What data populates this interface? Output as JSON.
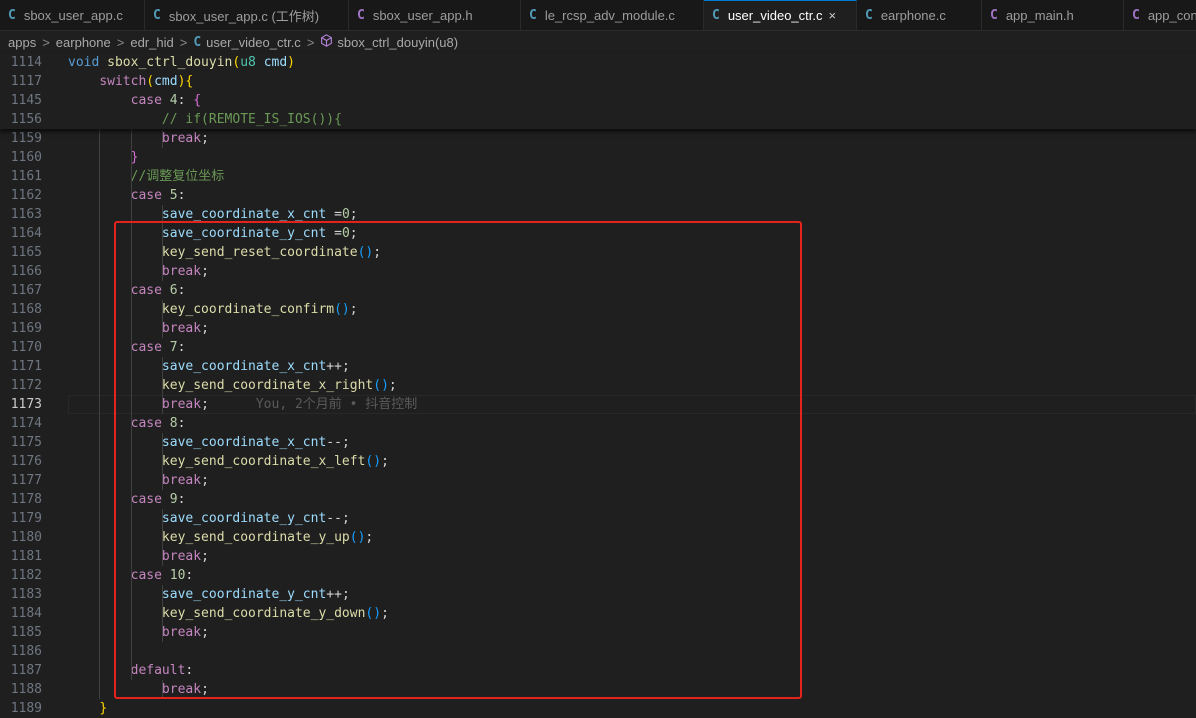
{
  "tabs": [
    {
      "icon": "C",
      "label": "sbox_user_app.c",
      "icon_color": "#519aba",
      "active": false
    },
    {
      "icon": "C",
      "label": "sbox_user_app.c (工作树)",
      "icon_color": "#519aba",
      "active": false
    },
    {
      "icon": "C",
      "label": "sbox_user_app.h",
      "icon_color": "#a074c4",
      "active": false
    },
    {
      "icon": "C",
      "label": "le_rcsp_adv_module.c",
      "icon_color": "#519aba",
      "active": false
    },
    {
      "icon": "C",
      "label": "user_video_ctr.c",
      "icon_color": "#519aba",
      "active": true,
      "close": "×"
    },
    {
      "icon": "C",
      "label": "earphone.c",
      "icon_color": "#519aba",
      "active": false
    },
    {
      "icon": "C",
      "label": "app_main.h",
      "icon_color": "#a074c4",
      "active": false
    },
    {
      "icon": "C",
      "label": "app_config.h",
      "icon_color": "#a074c4",
      "active": false
    }
  ],
  "breadcrumb": {
    "items": [
      "apps",
      "earphone",
      "edr_hid"
    ],
    "file_icon": "C",
    "file": "user_video_ctr.c",
    "symbol_icon": "cube-icon",
    "symbol": "sbox_ctrl_douyin(u8)"
  },
  "sticky_lines": [
    {
      "n": "1114",
      "t": [
        [
          "void",
          "kw"
        ],
        [
          " ",
          ""
        ],
        [
          "sbox_ctrl_douyin",
          "fn"
        ],
        [
          "(",
          "p1"
        ],
        [
          "u8",
          "ty"
        ],
        [
          " ",
          ""
        ],
        [
          "cmd",
          "var"
        ],
        [
          ")",
          "p1"
        ]
      ]
    },
    {
      "n": "1117",
      "t": [
        [
          "    ",
          ""
        ],
        [
          "switch",
          "ctl"
        ],
        [
          "(",
          "p1"
        ],
        [
          "cmd",
          "var"
        ],
        [
          ")",
          "p1"
        ],
        [
          "{",
          "p1"
        ]
      ]
    },
    {
      "n": "1145",
      "t": [
        [
          "        ",
          ""
        ],
        [
          "case",
          "ctl"
        ],
        [
          " ",
          ""
        ],
        [
          "4",
          "num"
        ],
        [
          ": ",
          "op"
        ],
        [
          "{",
          "p2"
        ]
      ]
    },
    {
      "n": "1156",
      "t": [
        [
          "            ",
          ""
        ],
        [
          "// if(REMOTE_IS_IOS()){",
          "cm"
        ]
      ]
    }
  ],
  "lines": [
    {
      "n": "1159",
      "t": [
        [
          "            ",
          ""
        ],
        [
          "break",
          "ctl"
        ],
        [
          ";",
          "op"
        ]
      ]
    },
    {
      "n": "1160",
      "t": [
        [
          "        ",
          ""
        ],
        [
          "}",
          "p2"
        ]
      ]
    },
    {
      "n": "1161",
      "t": [
        [
          "        ",
          ""
        ],
        [
          "//调整复位坐标",
          "cm"
        ]
      ]
    },
    {
      "n": "1162",
      "t": [
        [
          "        ",
          ""
        ],
        [
          "case",
          "ctl"
        ],
        [
          " ",
          ""
        ],
        [
          "5",
          "num"
        ],
        [
          ":",
          "op"
        ]
      ]
    },
    {
      "n": "1163",
      "t": [
        [
          "            ",
          ""
        ],
        [
          "save_coordinate_x_cnt",
          "var"
        ],
        [
          " =",
          "op"
        ],
        [
          "0",
          "num"
        ],
        [
          ";",
          "op"
        ]
      ]
    },
    {
      "n": "1164",
      "t": [
        [
          "            ",
          ""
        ],
        [
          "save_coordinate_y_cnt",
          "var"
        ],
        [
          " =",
          "op"
        ],
        [
          "0",
          "num"
        ],
        [
          ";",
          "op"
        ]
      ]
    },
    {
      "n": "1165",
      "t": [
        [
          "            ",
          ""
        ],
        [
          "key_send_reset_coordinate",
          "fn"
        ],
        [
          "()",
          "p3"
        ],
        [
          ";",
          "op"
        ]
      ]
    },
    {
      "n": "1166",
      "t": [
        [
          "            ",
          ""
        ],
        [
          "break",
          "ctl"
        ],
        [
          ";",
          "op"
        ]
      ]
    },
    {
      "n": "1167",
      "t": [
        [
          "        ",
          ""
        ],
        [
          "case",
          "ctl"
        ],
        [
          " ",
          ""
        ],
        [
          "6",
          "num"
        ],
        [
          ":",
          "op"
        ]
      ]
    },
    {
      "n": "1168",
      "t": [
        [
          "            ",
          ""
        ],
        [
          "key_coordinate_confirm",
          "fn"
        ],
        [
          "()",
          "p3"
        ],
        [
          ";",
          "op"
        ]
      ]
    },
    {
      "n": "1169",
      "t": [
        [
          "            ",
          ""
        ],
        [
          "break",
          "ctl"
        ],
        [
          ";",
          "op"
        ]
      ]
    },
    {
      "n": "1170",
      "t": [
        [
          "        ",
          ""
        ],
        [
          "case",
          "ctl"
        ],
        [
          " ",
          ""
        ],
        [
          "7",
          "num"
        ],
        [
          ":",
          "op"
        ]
      ]
    },
    {
      "n": "1171",
      "t": [
        [
          "            ",
          ""
        ],
        [
          "save_coordinate_x_cnt",
          "var"
        ],
        [
          "++;",
          "op"
        ]
      ]
    },
    {
      "n": "1172",
      "t": [
        [
          "            ",
          ""
        ],
        [
          "key_send_coordinate_x_right",
          "fn"
        ],
        [
          "()",
          "p3"
        ],
        [
          ";",
          "op"
        ]
      ]
    },
    {
      "n": "1173",
      "t": [
        [
          "            ",
          ""
        ],
        [
          "break",
          "ctl"
        ],
        [
          ";",
          "op"
        ]
      ],
      "current": true,
      "blame": "You, 2个月前 • 抖音控制"
    },
    {
      "n": "1174",
      "t": [
        [
          "        ",
          ""
        ],
        [
          "case",
          "ctl"
        ],
        [
          " ",
          ""
        ],
        [
          "8",
          "num"
        ],
        [
          ":",
          "op"
        ]
      ]
    },
    {
      "n": "1175",
      "t": [
        [
          "            ",
          ""
        ],
        [
          "save_coordinate_x_cnt",
          "var"
        ],
        [
          "--;",
          "op"
        ]
      ]
    },
    {
      "n": "1176",
      "t": [
        [
          "            ",
          ""
        ],
        [
          "key_send_coordinate_x_left",
          "fn"
        ],
        [
          "()",
          "p3"
        ],
        [
          ";",
          "op"
        ]
      ]
    },
    {
      "n": "1177",
      "t": [
        [
          "            ",
          ""
        ],
        [
          "break",
          "ctl"
        ],
        [
          ";",
          "op"
        ]
      ]
    },
    {
      "n": "1178",
      "t": [
        [
          "        ",
          ""
        ],
        [
          "case",
          "ctl"
        ],
        [
          " ",
          ""
        ],
        [
          "9",
          "num"
        ],
        [
          ":",
          "op"
        ]
      ]
    },
    {
      "n": "1179",
      "t": [
        [
          "            ",
          ""
        ],
        [
          "save_coordinate_y_cnt",
          "var"
        ],
        [
          "--;",
          "op"
        ]
      ]
    },
    {
      "n": "1180",
      "t": [
        [
          "            ",
          ""
        ],
        [
          "key_send_coordinate_y_up",
          "fn"
        ],
        [
          "()",
          "p3"
        ],
        [
          ";",
          "op"
        ]
      ]
    },
    {
      "n": "1181",
      "t": [
        [
          "            ",
          ""
        ],
        [
          "break",
          "ctl"
        ],
        [
          ";",
          "op"
        ]
      ]
    },
    {
      "n": "1182",
      "t": [
        [
          "        ",
          ""
        ],
        [
          "case",
          "ctl"
        ],
        [
          " ",
          ""
        ],
        [
          "10",
          "num"
        ],
        [
          ":",
          "op"
        ]
      ]
    },
    {
      "n": "1183",
      "t": [
        [
          "            ",
          ""
        ],
        [
          "save_coordinate_y_cnt",
          "var"
        ],
        [
          "++;",
          "op"
        ]
      ]
    },
    {
      "n": "1184",
      "t": [
        [
          "            ",
          ""
        ],
        [
          "key_send_coordinate_y_down",
          "fn"
        ],
        [
          "()",
          "p3"
        ],
        [
          ";",
          "op"
        ]
      ]
    },
    {
      "n": "1185",
      "t": [
        [
          "            ",
          ""
        ],
        [
          "break",
          "ctl"
        ],
        [
          ";",
          "op"
        ]
      ]
    },
    {
      "n": "1186",
      "t": []
    },
    {
      "n": "1187",
      "t": [
        [
          "        ",
          ""
        ],
        [
          "default",
          "ctl"
        ],
        [
          ":",
          "op"
        ]
      ]
    },
    {
      "n": "1188",
      "t": [
        [
          "            ",
          ""
        ],
        [
          "break",
          "ctl"
        ],
        [
          ";",
          "op"
        ]
      ]
    },
    {
      "n": "1189",
      "t": [
        [
          "    ",
          ""
        ],
        [
          "}",
          "p1"
        ]
      ]
    }
  ]
}
